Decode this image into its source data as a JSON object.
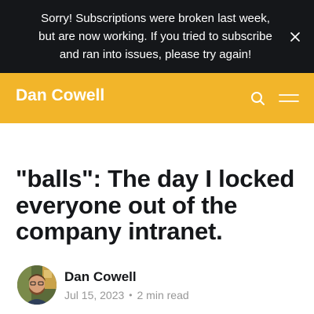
{
  "banner": {
    "text": "Sorry! Subscriptions were broken last week, but are now working. If you tried to subscribe and ran into issues, please try again!",
    "close_icon": "close-icon"
  },
  "header": {
    "site_title": "Dan Cowell",
    "search_icon": "search-icon",
    "menu_icon": "hamburger-menu-icon",
    "background": "#f2b52a"
  },
  "post": {
    "title": "\"balls\": The day I locked everyone out of the company intranet.",
    "author": "Dan Cowell",
    "date": "Jul 15, 2023",
    "separator": "•",
    "read_time": "2 min read"
  }
}
